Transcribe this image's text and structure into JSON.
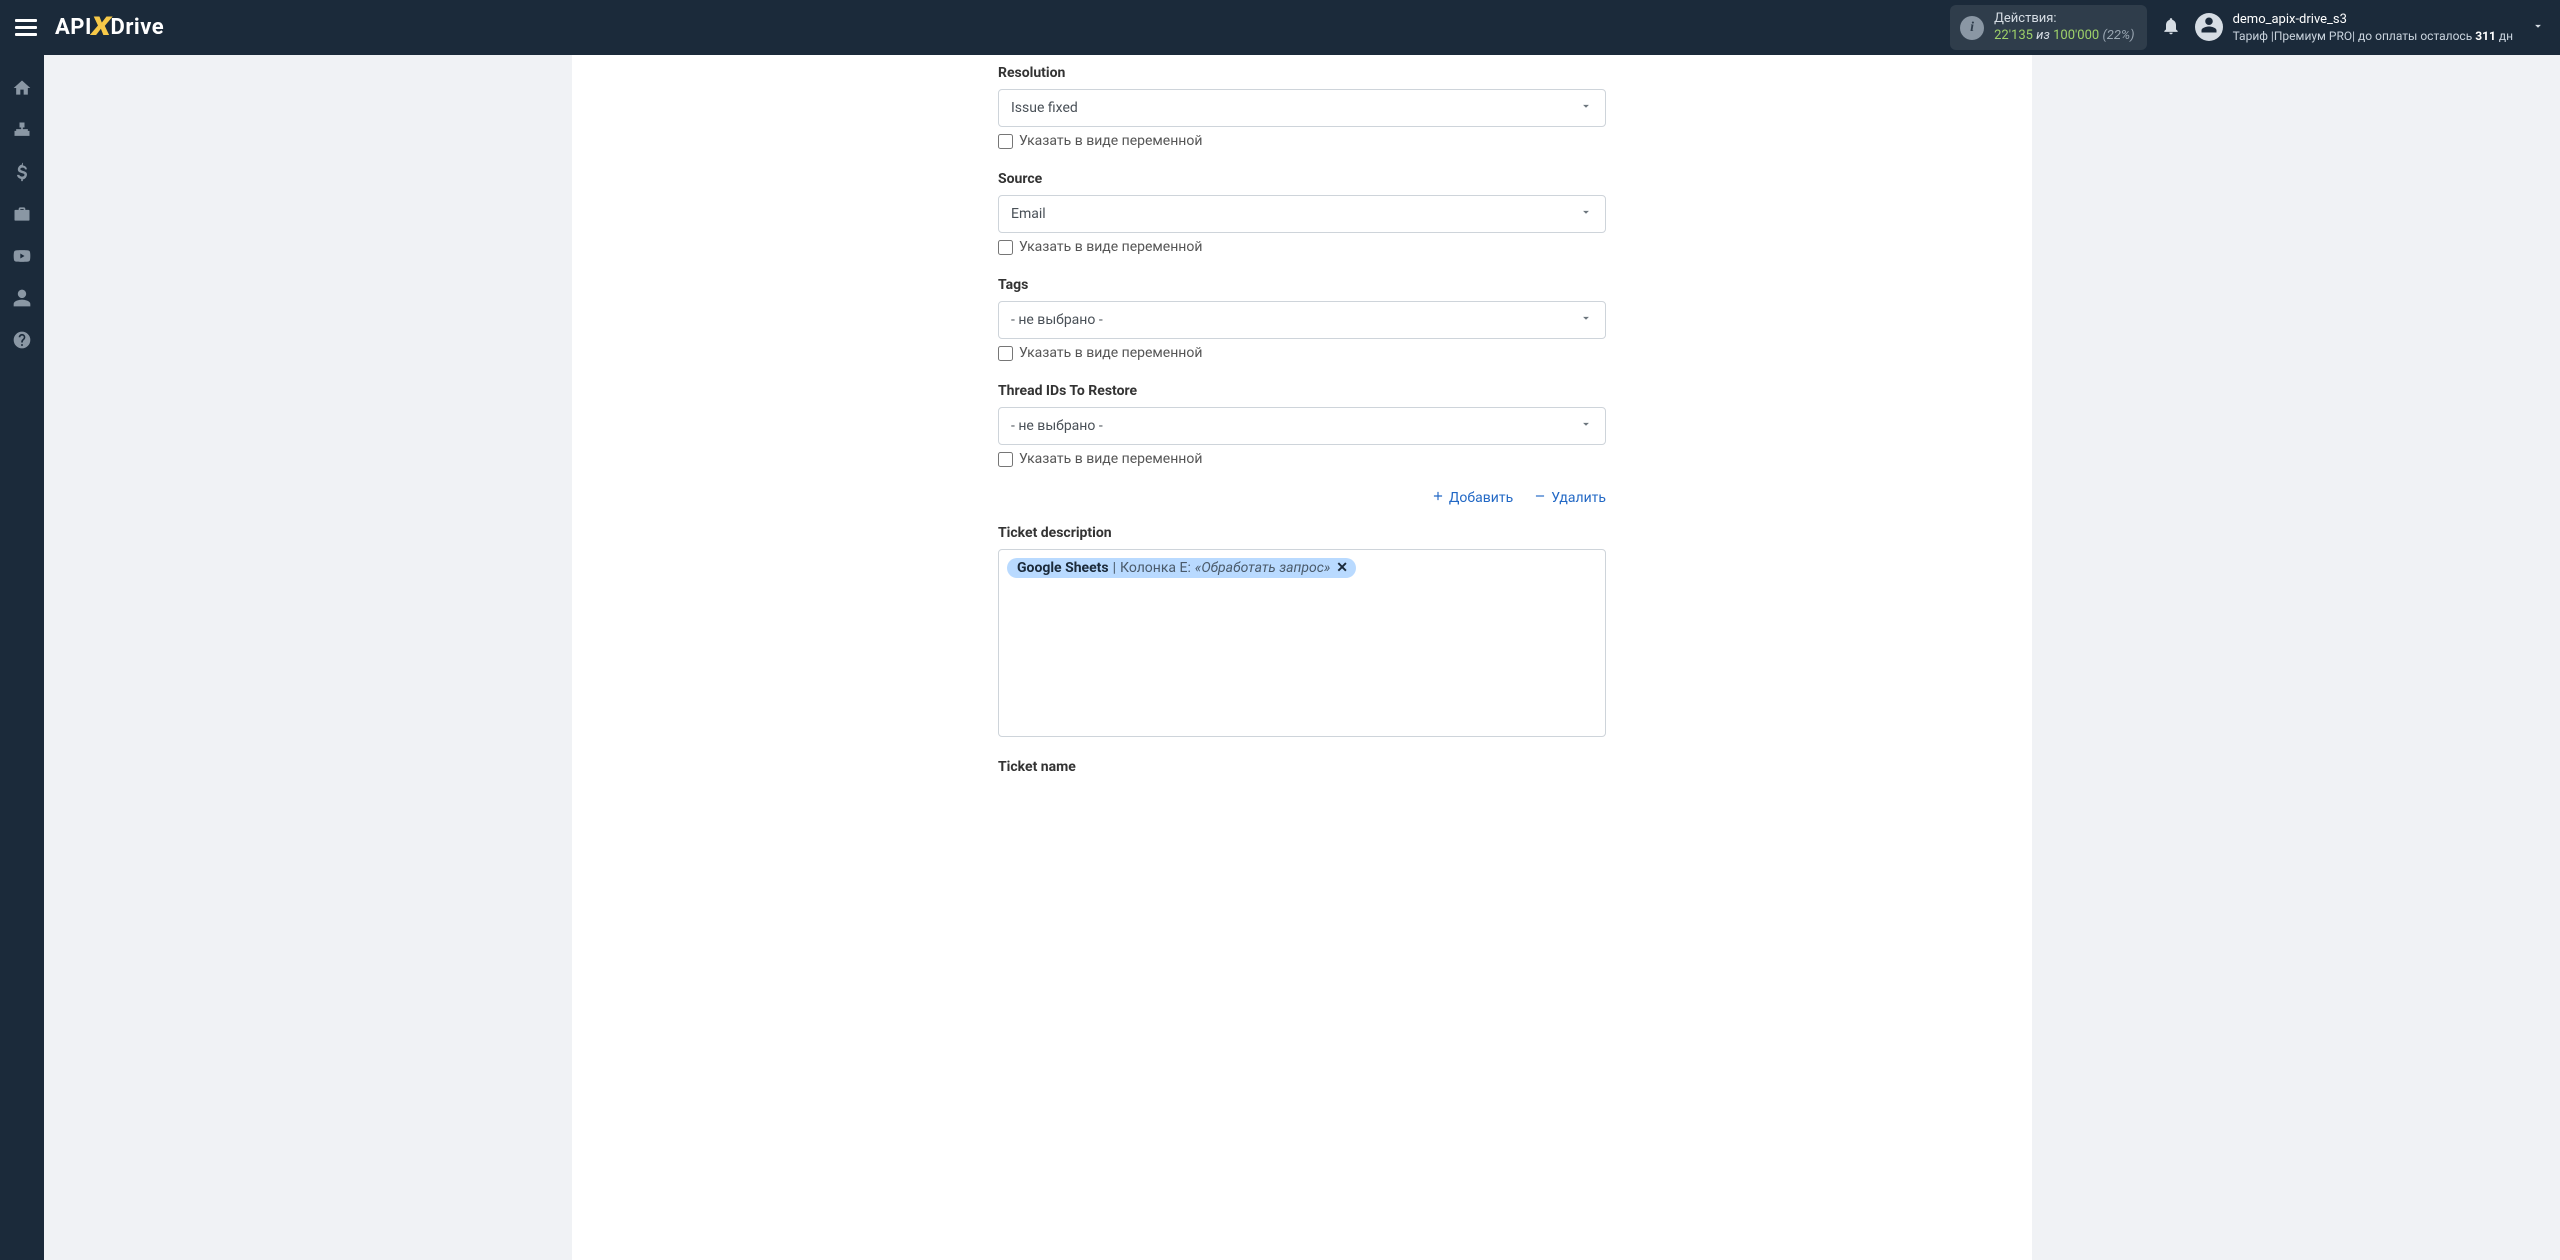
{
  "header": {
    "logo_api": "API",
    "logo_drive": "Drive",
    "actions_label": "Действия:",
    "actions_used": "22'135",
    "actions_of": "из",
    "actions_total": "100'000",
    "actions_pct": "(22%)",
    "user_name": "demo_apix-drive_s3",
    "plan_prefix": "Тариф |",
    "plan_name": "Премиум PRO",
    "plan_suffix": "|  до оплаты осталось ",
    "days_left": "311",
    "days_unit": " дн"
  },
  "form": {
    "variable_checkbox_label": "Указать в виде переменной",
    "not_selected": "- не выбрано -",
    "add_label": "Добавить",
    "delete_label": "Удалить",
    "fields": {
      "resolution": {
        "label": "Resolution",
        "value": "Issue fixed"
      },
      "source": {
        "label": "Source",
        "value": "Email"
      },
      "tags": {
        "label": "Tags"
      },
      "thread_ids": {
        "label": "Thread IDs To Restore"
      },
      "ticket_description": {
        "label": "Ticket description"
      },
      "ticket_name": {
        "label": "Ticket name"
      }
    },
    "desc_tag": {
      "source": "Google Sheets",
      "sep": " | ",
      "column_prefix": "Колонка E: ",
      "value": "«Обработать запрос»"
    }
  }
}
